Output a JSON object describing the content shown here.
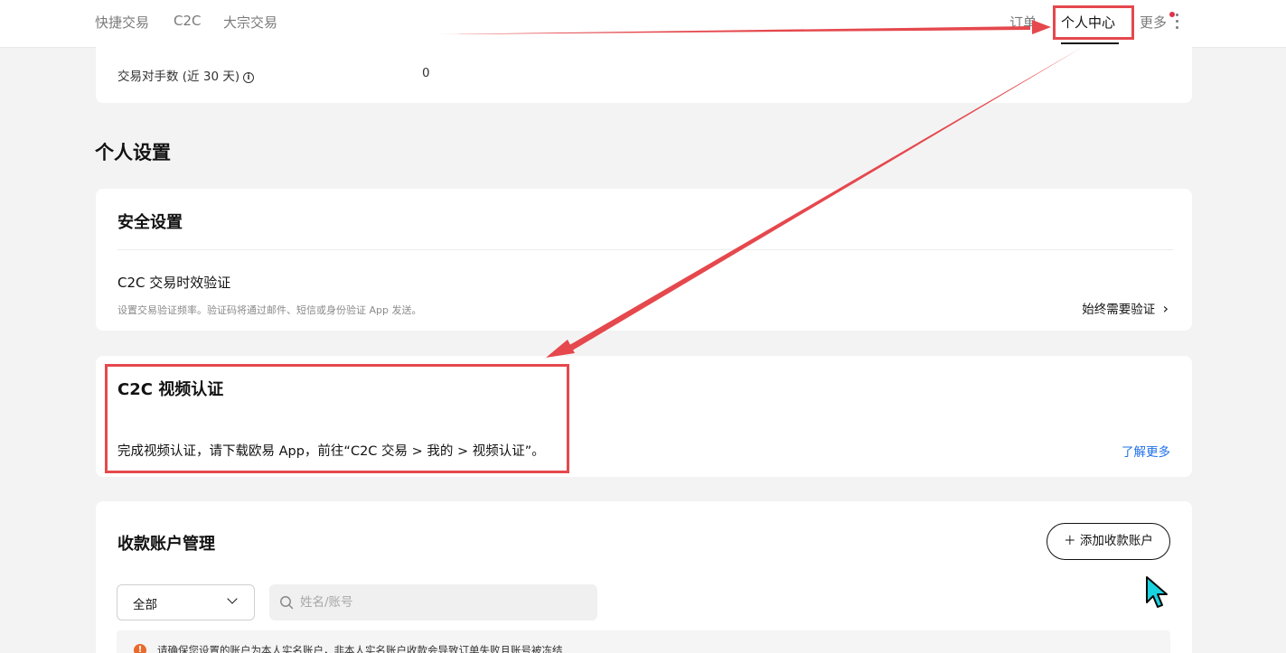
{
  "nav": {
    "left": [
      "快捷交易",
      "C2C",
      "大宗交易"
    ],
    "orders": "订单",
    "personal_center": "个人中心",
    "more": "更多"
  },
  "stats": {
    "counterparties_label": "交易对手数 (近 30 天)",
    "counterparties_value": "0",
    "info_glyph": "i"
  },
  "personal_settings": {
    "title": "个人设置"
  },
  "security": {
    "heading": "安全设置",
    "item_title": "C2C 交易时效验证",
    "item_desc": "设置交易验证频率。验证码将通过邮件、短信或身份验证 App 发送。",
    "item_action": "始终需要验证",
    "chevron": "›"
  },
  "video": {
    "heading": "C2C 视频认证",
    "desc": "完成视频认证，请下载欧易 App，前往“C2C 交易 > 我的 > 视频认证”。",
    "learn_more": "了解更多"
  },
  "payment": {
    "heading": "收款账户管理",
    "add_button": "＋ 添加收款账户",
    "filter_selected": "全部",
    "search_placeholder": "姓名/账号",
    "notice": "请确保您设置的账户为本人实名账户，非本人实名账户收款会导致订单失败且账号被冻结",
    "warn_glyph": "!"
  },
  "colors": {
    "annotation": "#e5484d",
    "link": "#1f6feb",
    "cursor": "#19d3e0"
  }
}
